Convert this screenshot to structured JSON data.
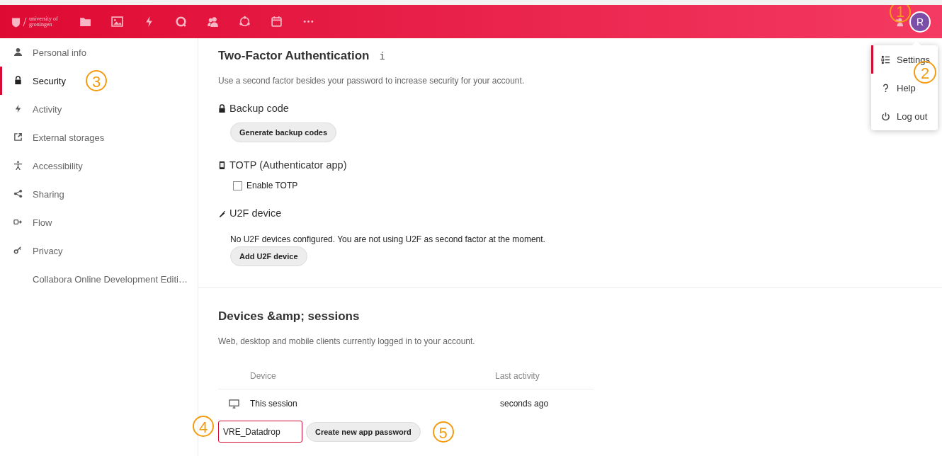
{
  "header": {
    "logo_text": [
      "university of",
      "groningen"
    ],
    "avatar": {
      "initial": "R",
      "callout": "1"
    }
  },
  "user_menu": [
    {
      "label": "Settings",
      "selected": true,
      "callout": "2"
    },
    {
      "label": "Help",
      "selected": false
    },
    {
      "label": "Log out",
      "selected": false
    }
  ],
  "sidebar": {
    "items": [
      {
        "label": "Personal info",
        "selected": false
      },
      {
        "label": "Security",
        "selected": true,
        "callout": "3"
      },
      {
        "label": "Activity",
        "selected": false
      },
      {
        "label": "External storages",
        "selected": false
      },
      {
        "label": "Accessibility",
        "selected": false
      },
      {
        "label": "Sharing",
        "selected": false
      },
      {
        "label": "Flow",
        "selected": false
      },
      {
        "label": "Privacy",
        "selected": false
      },
      {
        "label": "Collabora Online Development Editi…",
        "selected": false
      }
    ]
  },
  "two_factor": {
    "title": "Two-Factor Authentication",
    "info": "i",
    "description": "Use a second factor besides your password to increase security for your account.",
    "providers": [
      {
        "kind": "backup",
        "title": "Backup code",
        "button": "Generate backup codes"
      },
      {
        "kind": "totp",
        "title": "TOTP (Authenticator app)",
        "checkbox": {
          "label": "Enable TOTP",
          "checked": false
        }
      },
      {
        "kind": "u2f",
        "title": "U2F device",
        "text": "No U2F devices configured. You are not using U2F as second factor at the moment.",
        "button": "Add U2F device"
      }
    ]
  },
  "devices": {
    "title": "Devices &amp; sessions",
    "description": "Web, desktop and mobile clients currently logged in to your account.",
    "columns": [
      "Device",
      "Last activity"
    ],
    "rows": [
      {
        "device": "This session",
        "last_activity": "seconds ago"
      }
    ],
    "app_name": {
      "value": "VRE_Datadrop",
      "callout": "4"
    },
    "create_button": {
      "label": "Create new app password",
      "callout": "5"
    }
  }
}
